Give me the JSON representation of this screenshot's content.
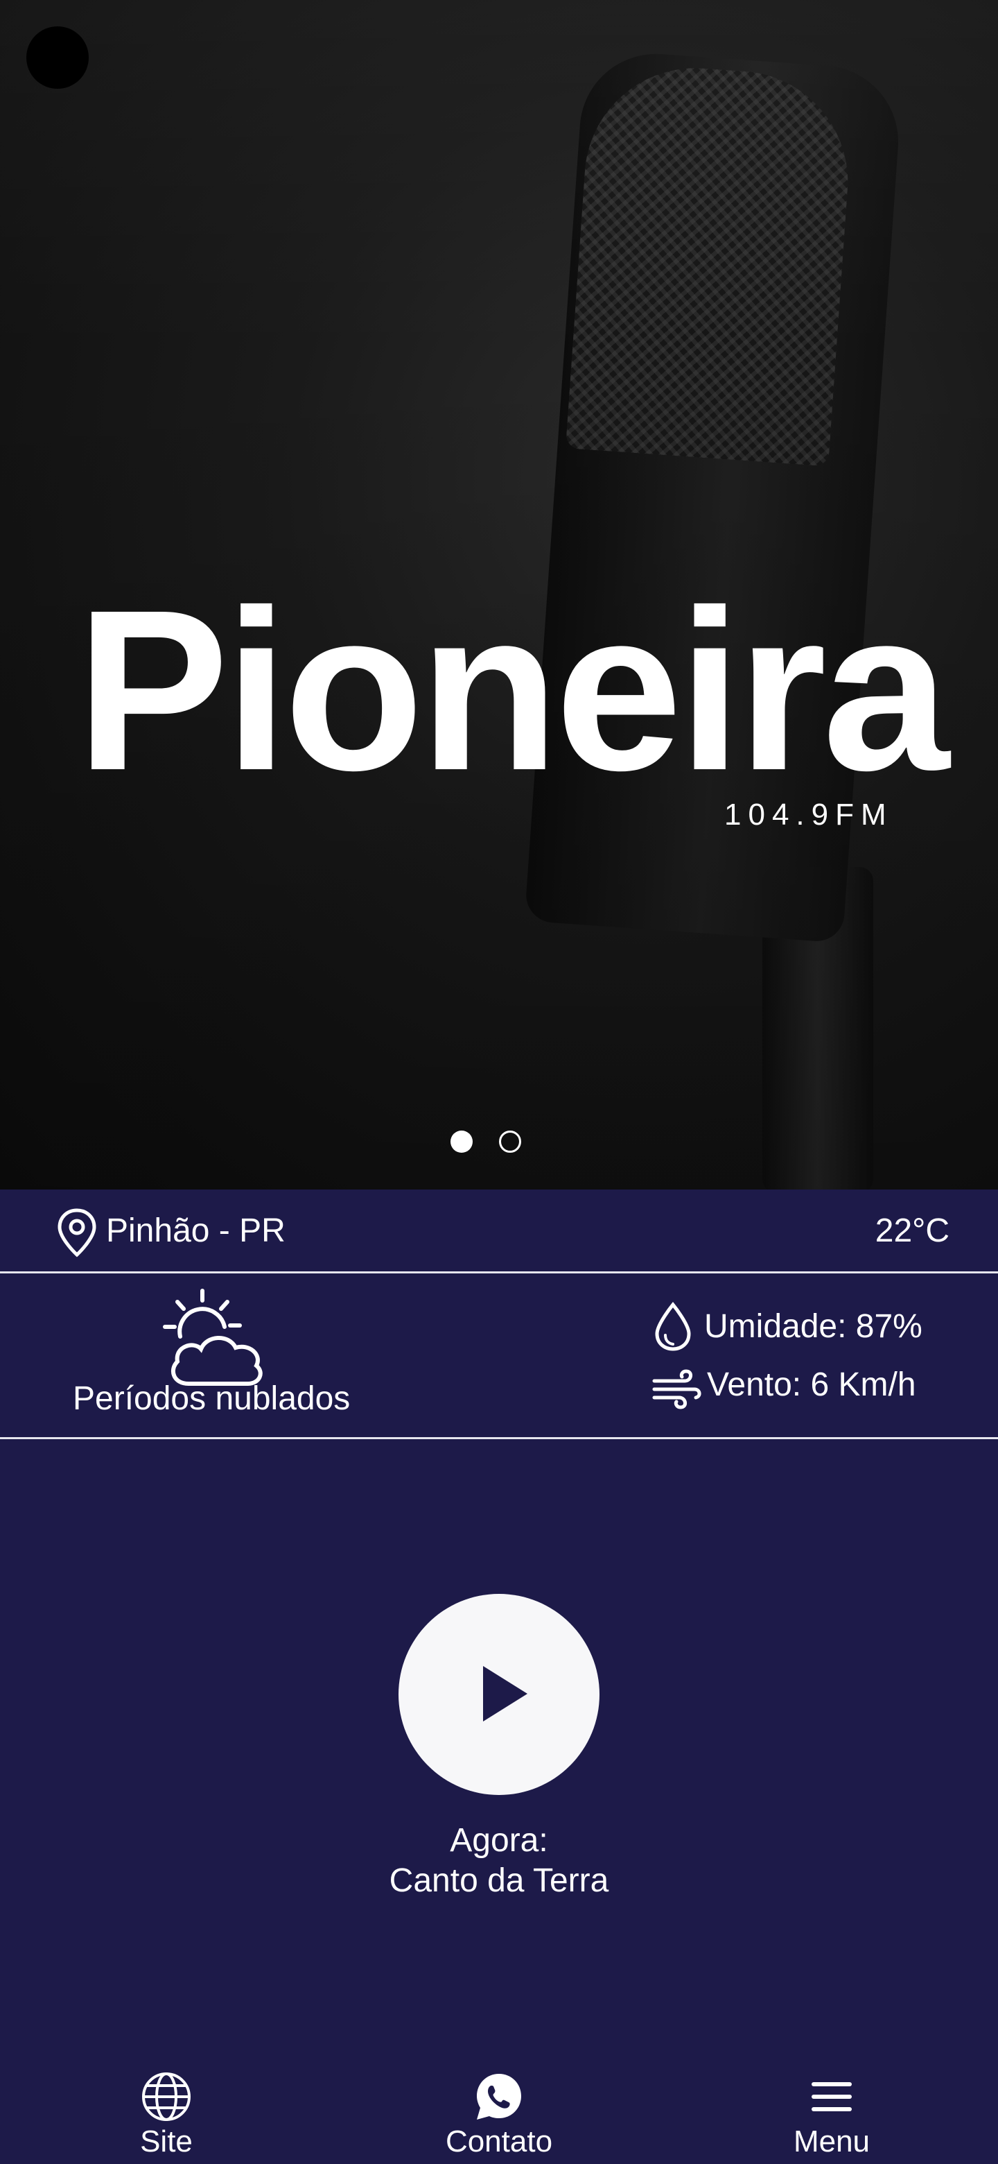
{
  "hero": {
    "logo_text": "Pioneira",
    "logo_frequency": "104.9FM",
    "carousel": {
      "slides": 2,
      "active_index": 0
    }
  },
  "location": {
    "city": "Pinhão - PR",
    "temperature": "22°C"
  },
  "weather": {
    "condition": "Períodos nublados",
    "humidity": "Umidade: 87%",
    "wind": "Vento: 6 Km/h"
  },
  "player": {
    "now_label": "Agora:",
    "now_title": "Canto da Terra",
    "state": "paused"
  },
  "nav": {
    "site_label": "Site",
    "contato_label": "Contato",
    "menu_label": "Menu"
  },
  "colors": {
    "background": "#1d1a49",
    "divider": "#e6e6ee",
    "play_button": "#f7f7f9",
    "wave_purple": "#6a1cf0",
    "wave_cyan": "#2fd6e6"
  },
  "icons": {
    "location": "map-pin-icon",
    "weather": "partly-cloudy-icon",
    "humidity": "water-drop-icon",
    "wind": "wind-icon",
    "play": "play-icon",
    "site": "globe-icon",
    "contato": "whatsapp-icon",
    "menu": "hamburger-menu-icon"
  }
}
